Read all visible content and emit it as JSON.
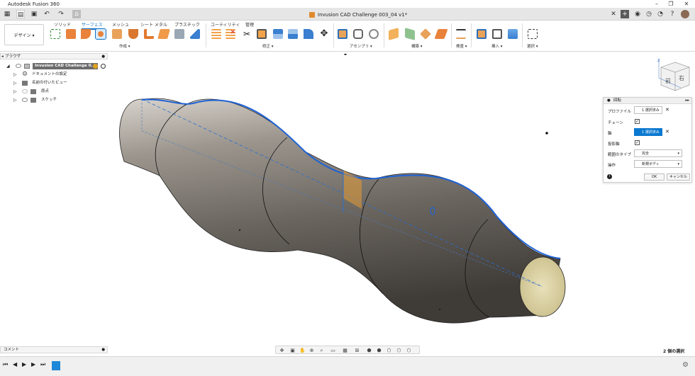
{
  "window": {
    "title": "Autodesk Fusion 360"
  },
  "document": {
    "title": "Invusion CAD Challenge 003_04 v1*"
  },
  "workspace": {
    "label": "デザイン ▾"
  },
  "tabs": [
    {
      "label": "ソリッド"
    },
    {
      "label": "サーフェス"
    },
    {
      "label": "メッシュ"
    },
    {
      "label": "シート メタル"
    },
    {
      "label": "プラスチック"
    },
    {
      "label": "ユーティリティ"
    },
    {
      "label": "管理"
    }
  ],
  "groups": [
    {
      "label": "作成 ▾"
    },
    {
      "label": "修正 ▾"
    },
    {
      "label": "アセンブリ ▾"
    },
    {
      "label": "構築 ▾"
    },
    {
      "label": "検査 ▾"
    },
    {
      "label": "挿入 ▾"
    },
    {
      "label": "選択 ▾"
    }
  ],
  "browser": {
    "header": "ブラウザ",
    "items": [
      {
        "label": "Invusion CAD Challenge 0..."
      },
      {
        "label": "ドキュメントの設定"
      },
      {
        "label": "名前の付いたビュー"
      },
      {
        "label": "原点"
      },
      {
        "label": "スケッチ"
      }
    ]
  },
  "panel": {
    "title": "回転",
    "rows": {
      "profile": {
        "label": "プロファイル",
        "value": "1 選択済み"
      },
      "chain": {
        "label": "チェーン"
      },
      "axis": {
        "label": "軸",
        "value": "1 選択済み"
      },
      "project_axis": {
        "label": "投影軸"
      },
      "extent": {
        "label": "範囲のタイプ",
        "value": "完全"
      },
      "operation": {
        "label": "操作",
        "value": "新規ボディ"
      }
    },
    "ok": "OK",
    "cancel": "キャンセル"
  },
  "viewcube": {
    "front": "前",
    "right": "右",
    "z": "Z"
  },
  "comments": {
    "label": "コメント"
  },
  "status": {
    "selection": "2 個の選択"
  },
  "colors": {
    "accent": "#0b78d0",
    "ribbon_bg": "#e6e6e6",
    "body": "#7a7570",
    "profile_line": "#1f63d6",
    "cap": "#ddd3a8"
  }
}
